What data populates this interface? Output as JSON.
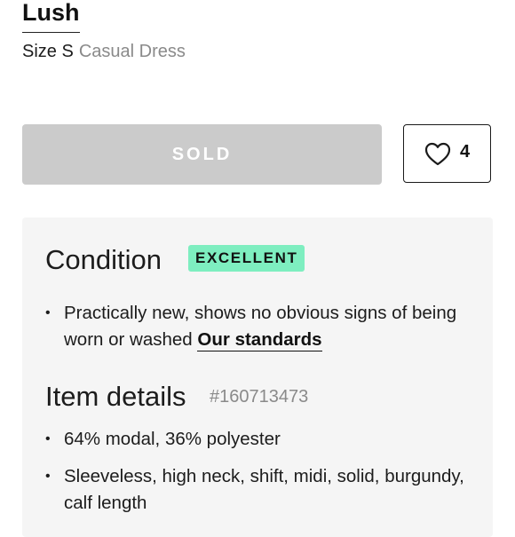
{
  "listing": {
    "brand": "Lush",
    "size_label": "Size S",
    "category": "Casual Dress"
  },
  "actions": {
    "sold_label": "SOLD",
    "like_icon": "heart-outline-icon",
    "like_count": "4"
  },
  "condition": {
    "title": "Condition",
    "badge": "EXCELLENT",
    "badge_color": "#7eeec0",
    "description": "Practically new, shows no obvious signs of being worn or washed",
    "standards_link": "Our standards"
  },
  "item_details": {
    "title": "Item details",
    "item_number": "#160713473",
    "bullets": [
      "64% modal, 36% polyester",
      "Sleeveless, high neck, shift, midi, solid, burgundy, calf length"
    ]
  },
  "colors": {
    "sold_button_bg": "#cbcbcb",
    "panel_bg": "#f5f5f5",
    "muted_text": "#8a8a8a"
  }
}
